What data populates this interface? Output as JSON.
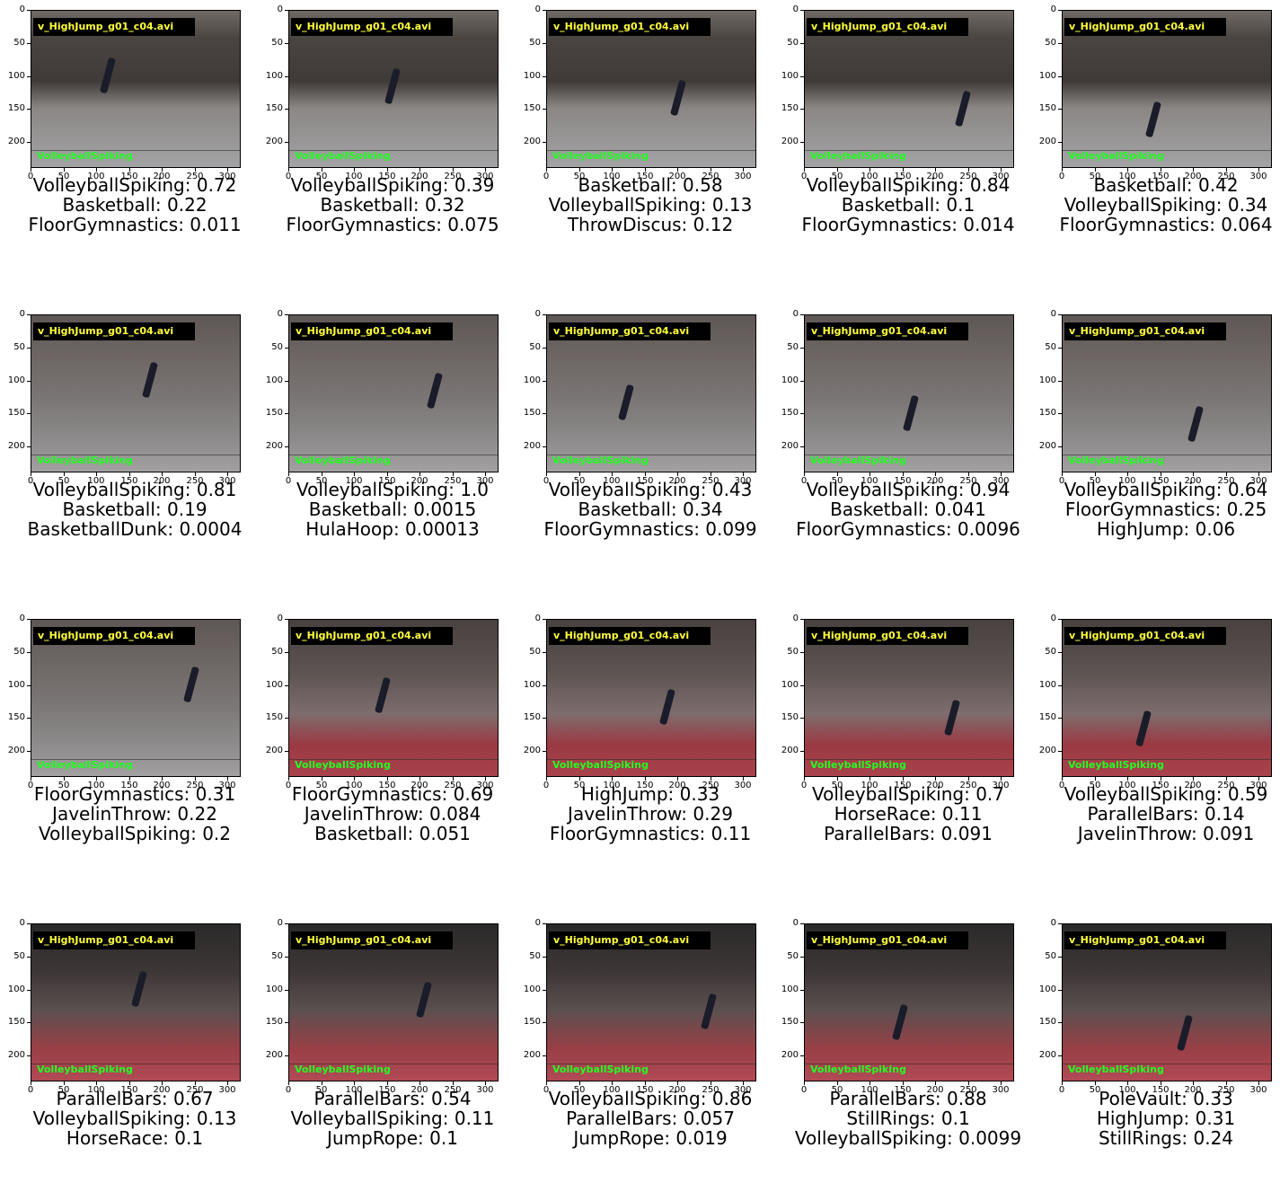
{
  "filename": "v_HighJump_g01_c04.avi",
  "overlay_label": "VolleyballSpiking",
  "y_ticks": [
    "0",
    "50",
    "100",
    "150",
    "200"
  ],
  "x_ticks": [
    "0",
    "50",
    "100",
    "150",
    "200",
    "250",
    "300"
  ],
  "panels": [
    {
      "lines": [
        "VolleyballSpiking: 0.72",
        "Basketball: 0.22",
        "FloorGymnastics: 0.011"
      ],
      "scene": "crowd"
    },
    {
      "lines": [
        "VolleyballSpiking: 0.39",
        "Basketball: 0.32",
        "FloorGymnastics: 0.075"
      ],
      "scene": "crowd"
    },
    {
      "lines": [
        "Basketball: 0.58",
        "VolleyballSpiking: 0.13",
        "ThrowDiscus: 0.12"
      ],
      "scene": "crowd"
    },
    {
      "lines": [
        "VolleyballSpiking: 0.84",
        "Basketball: 0.1",
        "FloorGymnastics: 0.014"
      ],
      "scene": "crowd"
    },
    {
      "lines": [
        "Basketball: 0.42",
        "VolleyballSpiking: 0.34",
        "FloorGymnastics: 0.064"
      ],
      "scene": "crowd"
    },
    {
      "lines": [
        "VolleyballSpiking: 0.81",
        "Basketball: 0.19",
        "BasketballDunk: 0.0004"
      ],
      "scene": "mid"
    },
    {
      "lines": [
        "VolleyballSpiking: 1.0",
        "Basketball: 0.0015",
        "HulaHoop: 0.00013"
      ],
      "scene": "mid"
    },
    {
      "lines": [
        "VolleyballSpiking: 0.43",
        "Basketball: 0.34",
        "FloorGymnastics: 0.099"
      ],
      "scene": "mid"
    },
    {
      "lines": [
        "VolleyballSpiking: 0.94",
        "Basketball: 0.041",
        "FloorGymnastics: 0.0096"
      ],
      "scene": "mid"
    },
    {
      "lines": [
        "VolleyballSpiking: 0.64",
        "FloorGymnastics: 0.25",
        "HighJump: 0.06"
      ],
      "scene": "mid"
    },
    {
      "lines": [
        "FloorGymnastics: 0.31",
        "JavelinThrow: 0.22",
        "VolleyballSpiking: 0.2"
      ],
      "scene": "mid"
    },
    {
      "lines": [
        "FloorGymnastics: 0.69",
        "JavelinThrow: 0.084",
        "Basketball: 0.051"
      ],
      "scene": "red"
    },
    {
      "lines": [
        "HighJump: 0.33",
        "JavelinThrow: 0.29",
        "FloorGymnastics: 0.11"
      ],
      "scene": "red"
    },
    {
      "lines": [
        "VolleyballSpiking: 0.7",
        "HorseRace: 0.11",
        "ParallelBars: 0.091"
      ],
      "scene": "red"
    },
    {
      "lines": [
        "VolleyballSpiking: 0.59",
        "ParallelBars: 0.14",
        "JavelinThrow: 0.091"
      ],
      "scene": "red"
    },
    {
      "lines": [
        "ParallelBars: 0.67",
        "VolleyballSpiking: 0.13",
        "HorseRace: 0.1"
      ],
      "scene": "dark"
    },
    {
      "lines": [
        "ParallelBars: 0.54",
        "VolleyballSpiking: 0.11",
        "JumpRope: 0.1"
      ],
      "scene": "dark"
    },
    {
      "lines": [
        "VolleyballSpiking: 0.86",
        "ParallelBars: 0.057",
        "JumpRope: 0.019"
      ],
      "scene": "dark"
    },
    {
      "lines": [
        "ParallelBars: 0.88",
        "StillRings: 0.1",
        "VolleyballSpiking: 0.0099"
      ],
      "scene": "dark"
    },
    {
      "lines": [
        "PoleVault: 0.33",
        "HighJump: 0.31",
        "StillRings: 0.24"
      ],
      "scene": "dark"
    }
  ]
}
